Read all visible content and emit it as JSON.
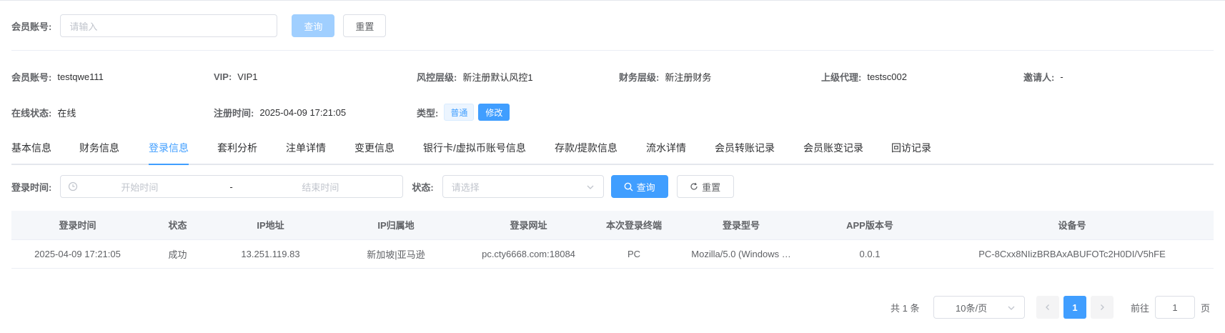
{
  "search": {
    "label": "会员账号:",
    "placeholder": "请输入",
    "query_btn": "查询",
    "reset_btn": "重置"
  },
  "info": {
    "account_key": "会员账号:",
    "account_val": "testqwe111",
    "vip_key": "VIP:",
    "vip_val": "VIP1",
    "risk_key": "风控层级:",
    "risk_val": "新注册默认风控1",
    "finance_key": "财务层级:",
    "finance_val": "新注册财务",
    "agent_key": "上级代理:",
    "agent_val": "testsc002",
    "inviter_key": "邀请人:",
    "inviter_val": "-",
    "online_key": "在线状态:",
    "online_val": "在线",
    "reg_key": "注册时间:",
    "reg_val": "2025-04-09 17:21:05",
    "type_key": "类型:",
    "type_tag": "普通",
    "type_edit": "修改"
  },
  "tabs": [
    "基本信息",
    "财务信息",
    "登录信息",
    "套利分析",
    "注单详情",
    "变更信息",
    "银行卡/虚拟币账号信息",
    "存款/提款信息",
    "流水详情",
    "会员转账记录",
    "会员账变记录",
    "回访记录"
  ],
  "filter": {
    "time_label": "登录时间:",
    "start_placeholder": "开始时间",
    "separator": "-",
    "end_placeholder": "结束时间",
    "status_label": "状态:",
    "status_placeholder": "请选择",
    "query_btn": "查询",
    "reset_btn": "重置"
  },
  "table": {
    "headers": [
      "登录时间",
      "状态",
      "IP地址",
      "IP归属地",
      "登录网址",
      "本次登录终端",
      "登录型号",
      "APP版本号",
      "设备号"
    ],
    "rows": [
      [
        "2025-04-09 17:21:05",
        "成功",
        "13.251.119.83",
        "新加坡|亚马逊",
        "pc.cty6668.com:18084",
        "PC",
        "Mozilla/5.0 (Windows …",
        "0.0.1",
        "PC-8Cxx8NIizBRBAxABUFOTc2H0DI/V5hFE"
      ]
    ]
  },
  "pagination": {
    "total": "共 1 条",
    "page_size": "10条/页",
    "current_page": "1",
    "goto_label": "前往",
    "goto_value": "1",
    "page_unit": "页"
  },
  "colors": {
    "primary": "#409eff",
    "primary_disabled": "#a0cfff"
  }
}
